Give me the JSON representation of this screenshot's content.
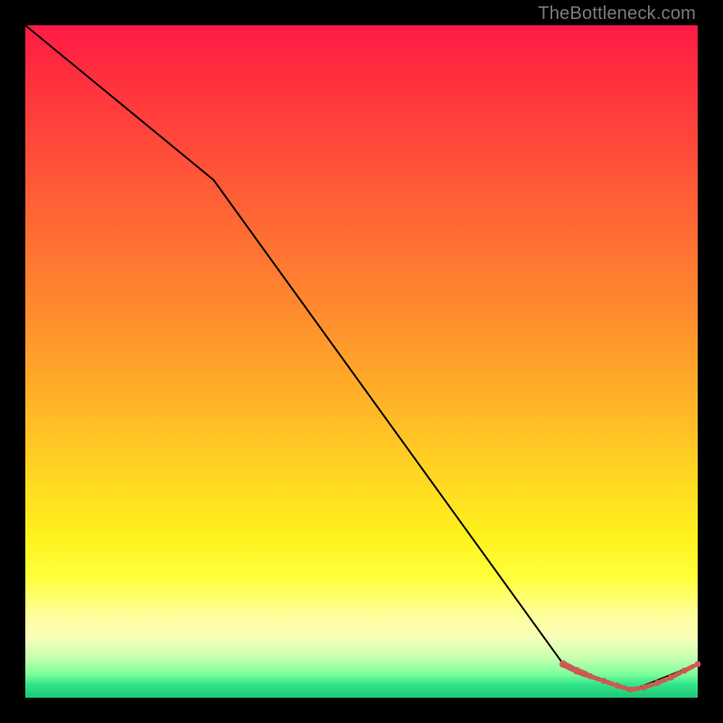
{
  "watermark": "TheBottleneck.com",
  "colors": {
    "dash_stroke": "#cc5a52",
    "dot_fill": "#cc5a52",
    "curve_stroke": "#000000"
  },
  "chart_data": {
    "type": "line",
    "title": "",
    "xlabel": "",
    "ylabel": "",
    "xlim": [
      0,
      100
    ],
    "ylim": [
      0,
      100
    ],
    "grid": false,
    "legend": false,
    "series": [
      {
        "name": "curve",
        "style": "solid-black",
        "x": [
          0,
          28,
          80,
          90,
          100
        ],
        "values": [
          100,
          77,
          5,
          1,
          5
        ]
      },
      {
        "name": "bottom-dashes",
        "style": "dashed-marker",
        "x": [
          80,
          82,
          84,
          86,
          88,
          90,
          92,
          94,
          96,
          98,
          100
        ],
        "values": [
          5,
          4,
          3.2,
          2.5,
          1.8,
          1.2,
          1.5,
          2.2,
          3,
          4,
          5
        ]
      }
    ],
    "annotations": []
  }
}
